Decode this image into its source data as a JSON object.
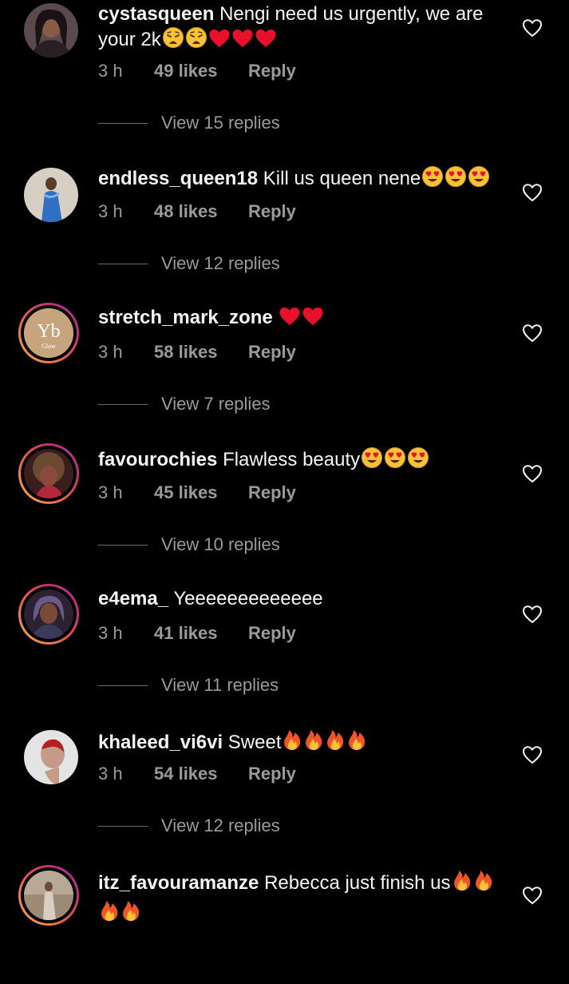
{
  "comments": [
    {
      "username": "cystasqueen",
      "text": "Nengi need us urgently, we are your 2k",
      "emojis": [
        "weary",
        "weary",
        "heart",
        "heart",
        "heart"
      ],
      "time": "3 h",
      "likes": "49 likes",
      "reply": "Reply",
      "replies": "View 15 replies"
    },
    {
      "username": "endless_queen18",
      "text": "Kill us queen nene",
      "emojis": [
        "heart-eyes",
        "heart-eyes",
        "heart-eyes"
      ],
      "time": "3 h",
      "likes": "48 likes",
      "reply": "Reply",
      "replies": "View 12 replies"
    },
    {
      "username": "stretch_mark_zone",
      "text": "",
      "emojis": [
        "heart",
        "heart"
      ],
      "time": "3 h",
      "likes": "58 likes",
      "reply": "Reply",
      "replies": "View 7 replies",
      "avatar_text": "Yb",
      "avatar_subtext": "Glow"
    },
    {
      "username": "favourochies",
      "text": "Flawless beauty",
      "emojis": [
        "heart-eyes",
        "heart-eyes",
        "heart-eyes"
      ],
      "time": "3 h",
      "likes": "45 likes",
      "reply": "Reply",
      "replies": "View 10 replies"
    },
    {
      "username": "e4ema_",
      "text": "Yeeeeeeeeeeeee",
      "emojis": [],
      "time": "3 h",
      "likes": "41 likes",
      "reply": "Reply",
      "replies": "View 11 replies"
    },
    {
      "username": "khaleed_vi6vi",
      "text": "Sweet",
      "emojis": [
        "fire",
        "fire",
        "fire",
        "fire"
      ],
      "time": "3 h",
      "likes": "54 likes",
      "reply": "Reply",
      "replies": "View 12 replies"
    },
    {
      "username": "itz_favouramanze",
      "text": "Rebecca just finish us",
      "emojis": [
        "fire",
        "fire",
        "fire",
        "fire"
      ],
      "time": "",
      "likes": "",
      "reply": "",
      "replies": ""
    }
  ],
  "icons": {
    "like": "heart-outline-icon"
  },
  "colors": {
    "background": "#000000",
    "text": "#f5f5f5",
    "secondary": "#9a9a9a",
    "story_ring_start": "#f7b14d",
    "story_ring_end": "#c1306f"
  }
}
